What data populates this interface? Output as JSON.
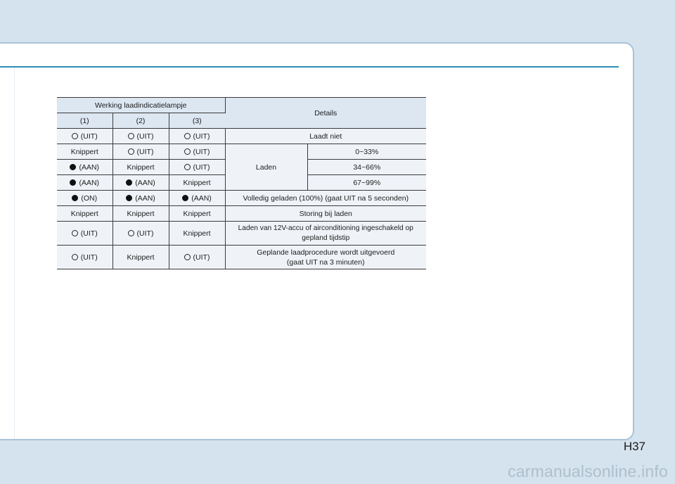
{
  "table": {
    "header": {
      "group_label": "Werking laadindicatielampje",
      "details_label": "Details",
      "col1": "(1)",
      "col2": "(2)",
      "col3": "(3)"
    },
    "rows": [
      {
        "c1": {
          "icon": "circle-outline-icon",
          "text": "(UIT)"
        },
        "c2": {
          "icon": "circle-outline-icon",
          "text": "(UIT)"
        },
        "c3": {
          "icon": "circle-outline-icon",
          "text": "(UIT)"
        },
        "detail": "Laadt niet"
      },
      {
        "c1": {
          "icon": "",
          "text": "Knippert"
        },
        "c2": {
          "icon": "circle-outline-icon",
          "text": "(UIT)"
        },
        "c3": {
          "icon": "circle-outline-icon",
          "text": "(UIT)"
        },
        "detail_group": "Laden",
        "detail": "0~33%"
      },
      {
        "c1": {
          "icon": "circle-filled-icon",
          "text": "(AAN)"
        },
        "c2": {
          "icon": "",
          "text": "Knippert"
        },
        "c3": {
          "icon": "circle-outline-icon",
          "text": "(UIT)"
        },
        "detail": "34~66%"
      },
      {
        "c1": {
          "icon": "circle-filled-icon",
          "text": "(AAN)"
        },
        "c2": {
          "icon": "circle-filled-icon",
          "text": "(AAN)"
        },
        "c3": {
          "icon": "",
          "text": "Knippert"
        },
        "detail": "67~99%"
      },
      {
        "c1": {
          "icon": "circle-filled-icon",
          "text": "(ON)"
        },
        "c2": {
          "icon": "circle-filled-icon",
          "text": "(AAN)"
        },
        "c3": {
          "icon": "circle-filled-icon",
          "text": "(AAN)"
        },
        "detail": "Volledig geladen (100%) (gaat UIT na 5 seconden)"
      },
      {
        "c1": {
          "icon": "",
          "text": "Knippert"
        },
        "c2": {
          "icon": "",
          "text": "Knippert"
        },
        "c3": {
          "icon": "",
          "text": "Knippert"
        },
        "detail": "Storing bij laden"
      },
      {
        "c1": {
          "icon": "circle-outline-icon",
          "text": "(UIT)"
        },
        "c2": {
          "icon": "circle-outline-icon",
          "text": "(UIT)"
        },
        "c3": {
          "icon": "",
          "text": "Knippert"
        },
        "detail_line1": "Laden van 12V-accu of airconditioning ingeschakeld op",
        "detail_line2": "gepland tijdstip"
      },
      {
        "c1": {
          "icon": "circle-outline-icon",
          "text": "(UIT)"
        },
        "c2": {
          "icon": "",
          "text": "Knippert"
        },
        "c3": {
          "icon": "circle-outline-icon",
          "text": "(UIT)"
        },
        "detail_line1": "Geplande laadprocedure wordt uitgevoerd",
        "detail_line2": "(gaat UIT na 3 minuten)"
      }
    ]
  },
  "page_number": "H37",
  "watermark": "carmanualsonline.info",
  "colors": {
    "background": "#d5e3ee",
    "accent_rule": "#2a8fb4",
    "header_fill": "#dce7f2",
    "row_fill": "#eff3f8"
  }
}
